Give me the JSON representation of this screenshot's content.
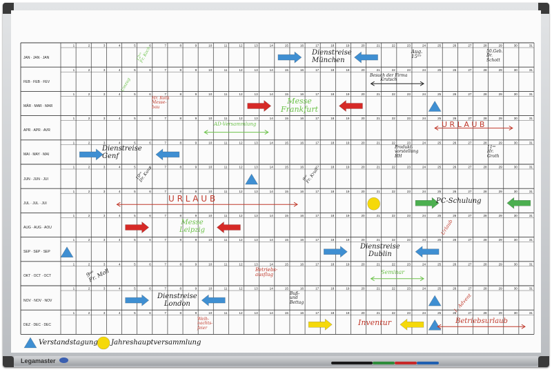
{
  "planner": {
    "months": [
      "JAN · JAN · JAN",
      "FEB · FEB · FEV",
      "MÄR · MAR · MAR",
      "APR · APR · AVR",
      "MAI · MAY · MAI",
      "JUN · JUN · JUI",
      "JUL · JUL · JUI",
      "AUG · AUG · AOU",
      "SEP · SEP · SEP",
      "OKT · OCT · OCT",
      "NOV · NOV · NOV",
      "DEZ · DEC · DEC"
    ],
    "days": [
      "1",
      "2",
      "3",
      "4",
      "5",
      "6",
      "7",
      "8",
      "9",
      "10",
      "11",
      "12",
      "13",
      "14",
      "15",
      "16",
      "17",
      "18",
      "19",
      "20",
      "21",
      "22",
      "23",
      "24",
      "25",
      "26",
      "27",
      "28",
      "29",
      "30",
      "31"
    ]
  },
  "notes": {
    "dienstreise_muenchen": "Dienstreise\nMünchen",
    "fr_koch": "12ᵘᵒ\nFr. Koch",
    "umzug": "Umzug",
    "geb_schott": "50.Geb.\nDr.\nSchott",
    "august_15": "Aug.\n15ᵘᵒ",
    "besuch_firma": "Besuch der Firma\nKrutsch",
    "hr_roth": "Hr. Roth\nMesse-\nbau",
    "messe_frankfurt": "Messe\nFrankfurt",
    "ad_versammlung": "AD-Versammlung",
    "urlaub_apr": "U R L A U B",
    "dienstreise_genf": "Dienstreise\nGenf",
    "produkt": "Produkt-\nvorstellung\nHH",
    "hr_groth": "11ᵘᵒ\nHr.\nGroth",
    "dr_kunz": "10ᵘᵒ\nDr. Kunz",
    "fr_krull": "9ᵘᵒ\nFr. Krull",
    "urlaub_jul": "U R L A U B",
    "pc_schulung": "PC-Schulung",
    "messe_leipzig": "Messe\nLeipzig",
    "urlaub_aug": "Urlaub",
    "dienstreise_dublin": "Dienstreise\nDublin",
    "fr_moll": "9ᵘᵒ\nFr. Moll",
    "betriebsausflug": "Betriebs-\nausflug",
    "seminar": "Seminar",
    "dienstreise_london": "Dienstreise\nLondon",
    "buss_bettag": "Buß-\nund\nBettag",
    "advent": "1. Advent",
    "weihnachtsfeier": "Weih-\nnachts-\nfeier",
    "inventur": "Inventur",
    "betriebsurlaub": "Betriebsurlaub"
  },
  "legend": {
    "triangle_label": "Verstandstagung",
    "circle_label": "Jahreshauptversammlung"
  },
  "brand": "Legamaster",
  "colors": {
    "blue": "#3f8fd2",
    "red": "#d62a27",
    "green": "#4caf50",
    "yellow": "#f5d90a",
    "grid": "#3b3b3b"
  }
}
